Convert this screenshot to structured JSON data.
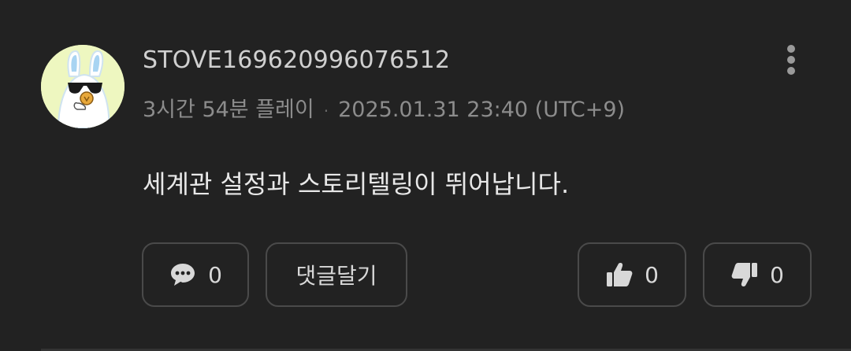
{
  "review": {
    "username": "STOVE169620996076512",
    "play_time": "3시간 54분 플레이",
    "separator": "·",
    "timestamp": "2025.01.31 23:40 (UTC+9)",
    "content": "세계관 설정과 스토리텔링이 뛰어납니다.",
    "avatar_icon": "sunglasses-rabbit-avatar",
    "more_icon": "more-vertical-icon"
  },
  "actions": {
    "replies": {
      "icon": "comment-bubble-icon",
      "count": "0"
    },
    "reply_label": "댓글달기",
    "like": {
      "icon": "thumbs-up-icon",
      "count": "0"
    },
    "dislike": {
      "icon": "thumbs-down-icon",
      "count": "0"
    }
  },
  "colors": {
    "background": "#222222",
    "border": "#4a4a4a",
    "avatar_bg": "#eef7c0",
    "primary_text": "#e8e8e8",
    "secondary_text": "#8c8c8c"
  }
}
